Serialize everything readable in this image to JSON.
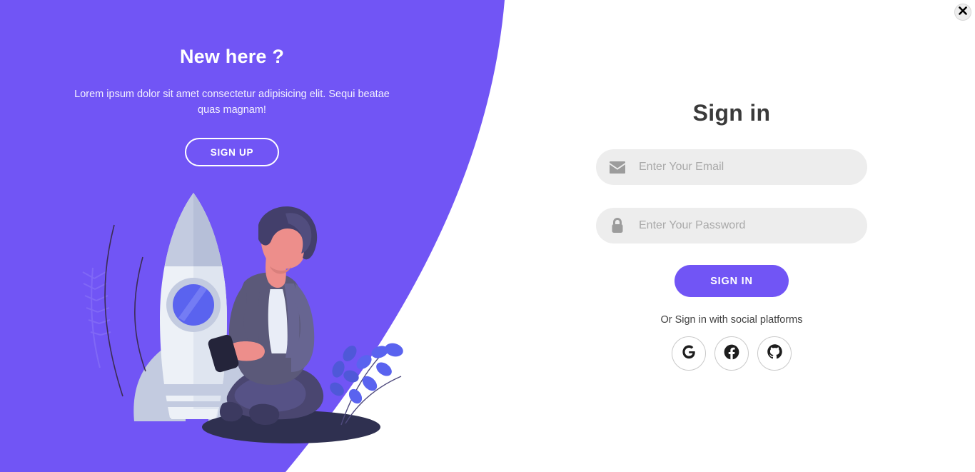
{
  "page": {
    "accent_purple": "#7155f5",
    "panel_bg": "#ffffff",
    "input_bg": "#ededed"
  },
  "close": {
    "label": "Close",
    "icon": "close-icon"
  },
  "promo": {
    "title": "New here ?",
    "description": "Lorem ipsum dolor sit amet consectetur adipisicing elit. Sequi beatae quas magnam!",
    "signup_label": "SIGN UP"
  },
  "illustration": {
    "name": "rocket-and-person-illustration",
    "elements": [
      "rocket",
      "seated-person-with-phone",
      "plant-branches",
      "ground-shadow",
      "smoke-lines"
    ]
  },
  "form": {
    "title": "Sign in",
    "email": {
      "icon": "envelope-icon",
      "placeholder": "Enter Your Email",
      "value": ""
    },
    "password": {
      "icon": "lock-icon",
      "placeholder": "Enter Your Password",
      "value": ""
    },
    "submit_label": "SIGN IN",
    "social_note": "Or Sign in with social platforms",
    "social": [
      {
        "name": "google",
        "icon": "google-icon",
        "label": "G"
      },
      {
        "name": "facebook",
        "icon": "facebook-icon",
        "label": "f"
      },
      {
        "name": "github",
        "icon": "github-icon",
        "label": ""
      }
    ]
  }
}
